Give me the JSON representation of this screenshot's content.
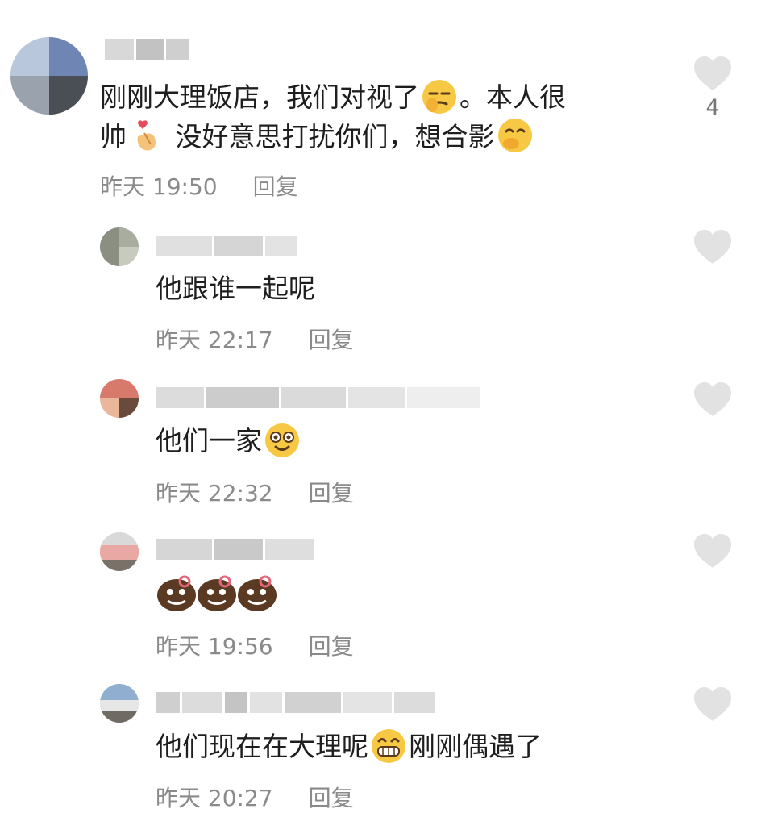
{
  "comments": [
    {
      "text": "刚刚大理饭店，我们对视了",
      "text_cont": "。本人很",
      "text_line2a": "帅",
      "text_line2b": " 没好意思打扰你们，想合影",
      "time": "昨天 19:50",
      "reply_label": "回复",
      "like_count": "4",
      "emoji": [
        "smirk-emoji",
        "finger-heart-emoji",
        "covering-mouth-emoji"
      ]
    },
    {
      "text": "他跟谁一起呢",
      "time": "昨天 22:17",
      "reply_label": "回复"
    },
    {
      "text": "他们一家",
      "time": "昨天 22:32",
      "reply_label": "回复",
      "emoji": [
        "smiling-emoji"
      ]
    },
    {
      "text": "",
      "time": "昨天 19:56",
      "reply_label": "回复",
      "emoji": [
        "brown-face-emoji",
        "brown-face-emoji",
        "brown-face-emoji"
      ]
    },
    {
      "text": "他们现在在大理呢",
      "text_after": "刚刚偶遇了",
      "time": "昨天 20:27",
      "reply_label": "回复",
      "emoji": [
        "grinning-emoji"
      ]
    }
  ],
  "colors": {
    "text": "#1e1e1e",
    "meta": "#8a8a8a",
    "like": "#e2e2e2",
    "emoji_yellow": "#f7c843",
    "emoji_brown": "#5b3a24"
  }
}
